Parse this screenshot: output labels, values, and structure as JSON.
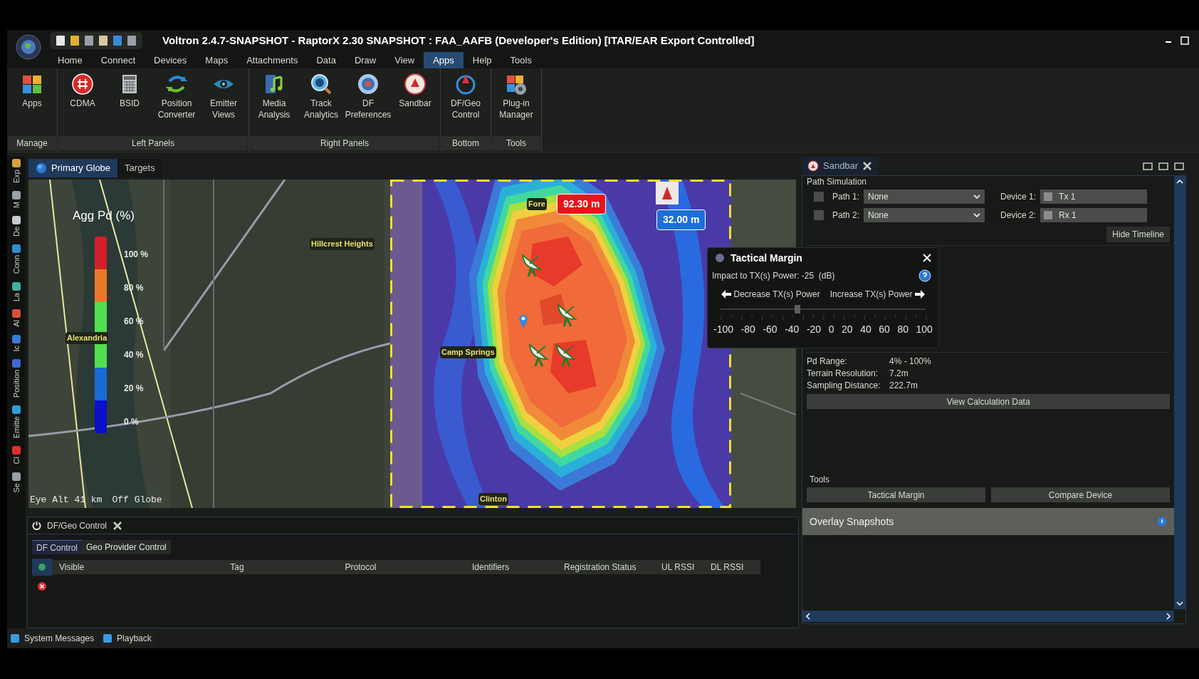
{
  "title_bar": {
    "title": "Voltron 2.4.7-SNAPSHOT - RaptorX 2.30 SNAPSHOT : FAA_AAFB (Developer's Edition) [ITAR/EAR Export Controlled]"
  },
  "menu": [
    {
      "label": "Home",
      "selected": false
    },
    {
      "label": "Connect",
      "selected": false
    },
    {
      "label": "Devices",
      "selected": false
    },
    {
      "label": "Maps",
      "selected": false
    },
    {
      "label": "Attachments",
      "selected": false
    },
    {
      "label": "Data",
      "selected": false
    },
    {
      "label": "Draw",
      "selected": false
    },
    {
      "label": "View",
      "selected": false
    },
    {
      "label": "Apps",
      "selected": true
    },
    {
      "label": "Help",
      "selected": false
    },
    {
      "label": "Tools",
      "selected": false
    }
  ],
  "ribbon": [
    {
      "label": "Manage",
      "items": [
        {
          "label": "Apps",
          "kind": "puzzle"
        }
      ]
    },
    {
      "label": "Left Panels",
      "items": [
        {
          "label": "CDMA",
          "kind": "hash"
        },
        {
          "label": "BSID",
          "kind": "calculator"
        },
        {
          "label": "Position Converter",
          "kind": "arrows"
        },
        {
          "label": "Emitter Views",
          "kind": "eye"
        }
      ]
    },
    {
      "label": "Right Panels",
      "items": [
        {
          "label": "Media Analysis",
          "kind": "media"
        },
        {
          "label": "Track Analytics",
          "kind": "magnifier"
        },
        {
          "label": "DF Preferences",
          "kind": "gear"
        },
        {
          "label": "Sandbar",
          "kind": "sandbar"
        }
      ]
    },
    {
      "label": "Bottom",
      "items": [
        {
          "label": "DF/Geo Control",
          "kind": "compass"
        }
      ]
    },
    {
      "label": "Tools",
      "items": [
        {
          "label": "Plug-in Manager",
          "kind": "plugin"
        }
      ]
    }
  ],
  "side_strip": [
    {
      "label": "Exp",
      "color": "#d9a23a"
    },
    {
      "label": "M",
      "color": "#9aa0a8"
    },
    {
      "label": "De",
      "color": "#c8ccd0"
    },
    {
      "label": "Conn",
      "color": "#2f8fd0"
    },
    {
      "label": "La",
      "color": "#3fb0a0"
    },
    {
      "label": "Al",
      "color": "#d8503a"
    },
    {
      "label": "Ic",
      "color": "#3a7ad8"
    },
    {
      "label": "Position",
      "color": "#3a6ad8"
    },
    {
      "label": "Emitte",
      "color": "#2aa0d8"
    },
    {
      "label": "Cl",
      "color": "#e03030"
    },
    {
      "label": "Se",
      "color": "#9aa0a8"
    }
  ],
  "map_tabs": [
    {
      "label": "Primary Globe",
      "selected": true
    },
    {
      "label": "Targets",
      "selected": false
    }
  ],
  "map": {
    "legend_title": "Agg Pd (%)",
    "legend_ticks": [
      "100 %",
      "80 %",
      "60 %",
      "40 %",
      "20 %",
      "0 %"
    ],
    "place_labels": [
      "Hillcrest Heights",
      "Alexandria",
      "Camp Springs",
      "Clinton",
      "Fore"
    ],
    "callouts": [
      {
        "text": "92.30 m",
        "color": "#e8141c"
      },
      {
        "text": "32.00 m",
        "color": "#1a6fd8"
      }
    ],
    "eye_alt": "Eye Alt 41 km",
    "globe_state": "Off Globe"
  },
  "tactical_margin": {
    "title": "Tactical Margin",
    "impact": "Impact to TX(s) Power: -25  (dB)",
    "decrease": "Decrease TX(s) Power",
    "increase": "Increase TX(s) Power",
    "slider": {
      "level": 0.375
    },
    "scale": [
      "-100",
      "-80",
      "-60",
      "-40",
      "-20",
      "0",
      "20",
      "40",
      "60",
      "80",
      "100"
    ]
  },
  "sandbar": {
    "tab": "Sandbar",
    "section": "Path Simulation",
    "paths": [
      {
        "label": "Path 1:",
        "value": "None",
        "checked": false
      },
      {
        "label": "Path 2:",
        "value": "None",
        "checked": false
      }
    ],
    "devices": [
      {
        "label": "Device 1:",
        "value": "Tx 1"
      },
      {
        "label": "Device 2:",
        "value": "Rx 1"
      }
    ],
    "hide_timeline": "Hide Timeline",
    "stats": [
      {
        "label": "Pd Range:",
        "value": "4% - 100%"
      },
      {
        "label": "Terrain Resolution:",
        "value": "7.2m"
      },
      {
        "label": "Sampling Distance:",
        "value": "222.7m"
      }
    ],
    "view_button": "View Calculation Data",
    "tools_title": "Tools",
    "tool_buttons": [
      "Tactical Margin",
      "Compare Device"
    ],
    "overlay_title": "Overlay Snapshots"
  },
  "df_geo": {
    "title": "DF/Geo Control",
    "tabs": [
      {
        "label": "DF Control",
        "selected": true
      },
      {
        "label": "Geo Provider Control",
        "selected": false
      }
    ],
    "columns": [
      "Visible",
      "Tag",
      "Protocol",
      "Identifiers",
      "Registration Status",
      "UL RSSI",
      "DL RSSI"
    ]
  },
  "status_bar": [
    {
      "label": "System Messages"
    },
    {
      "label": "Playback"
    }
  ]
}
